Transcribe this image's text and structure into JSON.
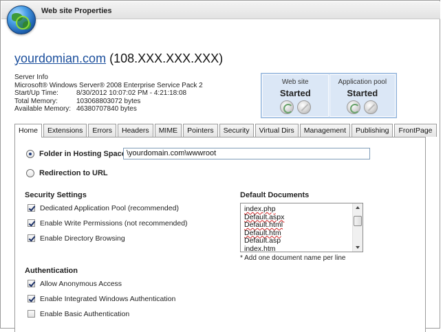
{
  "window": {
    "title": "Web site Properties"
  },
  "header": {
    "domain": "yourdomian.com",
    "ip": "(108.XXX.XXX.XXX)"
  },
  "server_info": {
    "heading": "Server Info",
    "os": "Microsoft® Windows Server® 2008 Enterprise Service Pack 2",
    "rows": [
      {
        "label": "Start/Up Time:",
        "value": "8/30/2012 10:07:02 PM - 4:21:18:08"
      },
      {
        "label": "Total Memory:",
        "value": "103068803072 bytes"
      },
      {
        "label": "Available Memory:",
        "value": "46380707840 bytes"
      }
    ]
  },
  "status": {
    "website": {
      "title": "Web site",
      "state": "Started"
    },
    "app_pool": {
      "title": "Application pool",
      "state": "Started"
    }
  },
  "tabs": [
    "Home",
    "Extensions",
    "Errors",
    "Headers",
    "MIME",
    "Pointers",
    "Security",
    "Virtual Dirs",
    "Management",
    "Publishing",
    "FrontPage"
  ],
  "active_tab": "Home",
  "home": {
    "folder_option": {
      "label": "Folder in Hosting Space",
      "value": "\\yourdomain.com\\wwwroot",
      "selected": true
    },
    "redirect_option": {
      "label": "Redirection to URL",
      "selected": false
    },
    "security": {
      "heading": "Security Settings",
      "items": [
        {
          "label": "Dedicated Application Pool (recommended)",
          "checked": true
        },
        {
          "label": "Enable Write Permissions (not recommended)",
          "checked": true
        },
        {
          "label": "Enable Directory Browsing",
          "checked": true
        }
      ]
    },
    "authentication": {
      "heading": "Authentication",
      "items": [
        {
          "label": "Allow Anonymous Access",
          "checked": true
        },
        {
          "label": "Enable Integrated Windows Authentication",
          "checked": true
        },
        {
          "label": "Enable Basic Authentication",
          "checked": false
        }
      ]
    },
    "default_documents": {
      "heading": "Default Documents",
      "items": [
        "index.php",
        "Default.aspx",
        "Default.html",
        "Default.htm",
        "Default.asp",
        "index.htm"
      ],
      "note": "* Add one document name per line"
    }
  }
}
